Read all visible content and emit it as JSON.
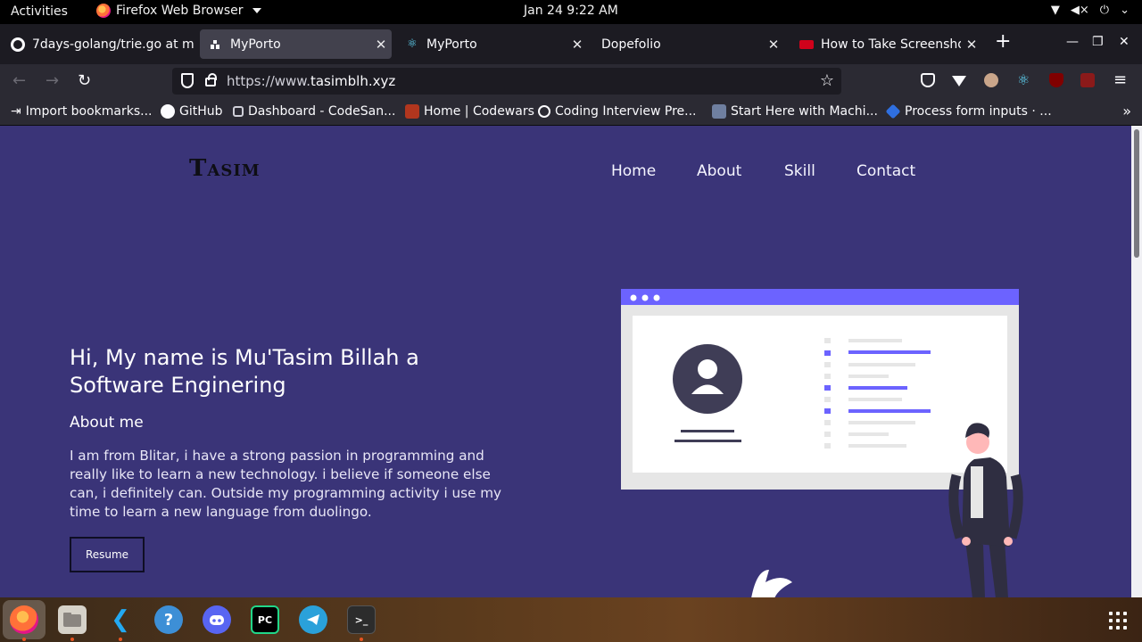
{
  "topbar": {
    "activities": "Activities",
    "app_name": "Firefox Web Browser",
    "clock": "Jan 24  9:22 AM",
    "tray_icons": [
      "wifi-icon",
      "volume-mute-icon",
      "power-icon",
      "chevron-down-icon"
    ]
  },
  "tabs": [
    {
      "title": "7days-golang/trie.go at m",
      "favicon": "github-icon",
      "active": false
    },
    {
      "title": "MyPorto",
      "favicon": "site-icon",
      "active": true
    },
    {
      "title": "MyPorto",
      "favicon": "react-icon",
      "active": false
    },
    {
      "title": "Dopefolio",
      "favicon": "",
      "active": false
    },
    {
      "title": "How to Take Screenshot",
      "favicon": "hub-icon",
      "active": false
    }
  ],
  "url": {
    "prefix": "https://www.",
    "domain": "tasimblh.xyz"
  },
  "bookmarks": [
    {
      "label": "Import bookmarks...",
      "color": "#fbfbfe"
    },
    {
      "label": "GitHub",
      "color": "#fbfbfe"
    },
    {
      "label": "Dashboard - CodeSan...",
      "color": "#cfcfd8"
    },
    {
      "label": "Home | Codewars",
      "color": "#b1361e"
    },
    {
      "label": "Coding Interview Pre...",
      "color": "#1c1b22"
    },
    {
      "label": "Start Here with Machi...",
      "color": "#6f7fa0"
    },
    {
      "label": "Process form inputs · ...",
      "color": "#2f6fe0"
    }
  ],
  "site": {
    "logo": {
      "first": "T",
      "rest": "ASIM"
    },
    "menu": [
      "Home",
      "About",
      "Skill",
      "Contact"
    ],
    "hero_title": "Hi, My name is Mu'Tasim Billah a Software Enginering",
    "about_heading": "About me",
    "about_text": "I am from Blitar, i have a strong passion in programming and really like to learn a new technology. i believe if someone else can, i definitely can. Outside my programming activity i use my time to learn a new language from duolingo.",
    "resume_label": "Resume",
    "background": "#3a3478",
    "accent": "#6c63ff"
  },
  "dock": [
    {
      "name": "firefox-icon",
      "running": true
    },
    {
      "name": "files-icon",
      "running": true
    },
    {
      "name": "vscode-icon",
      "running": true
    },
    {
      "name": "help-icon",
      "running": false
    },
    {
      "name": "discord-icon",
      "running": false
    },
    {
      "name": "pycharm-icon",
      "running": false
    },
    {
      "name": "telegram-icon",
      "running": false
    },
    {
      "name": "terminal-icon",
      "running": true
    }
  ]
}
